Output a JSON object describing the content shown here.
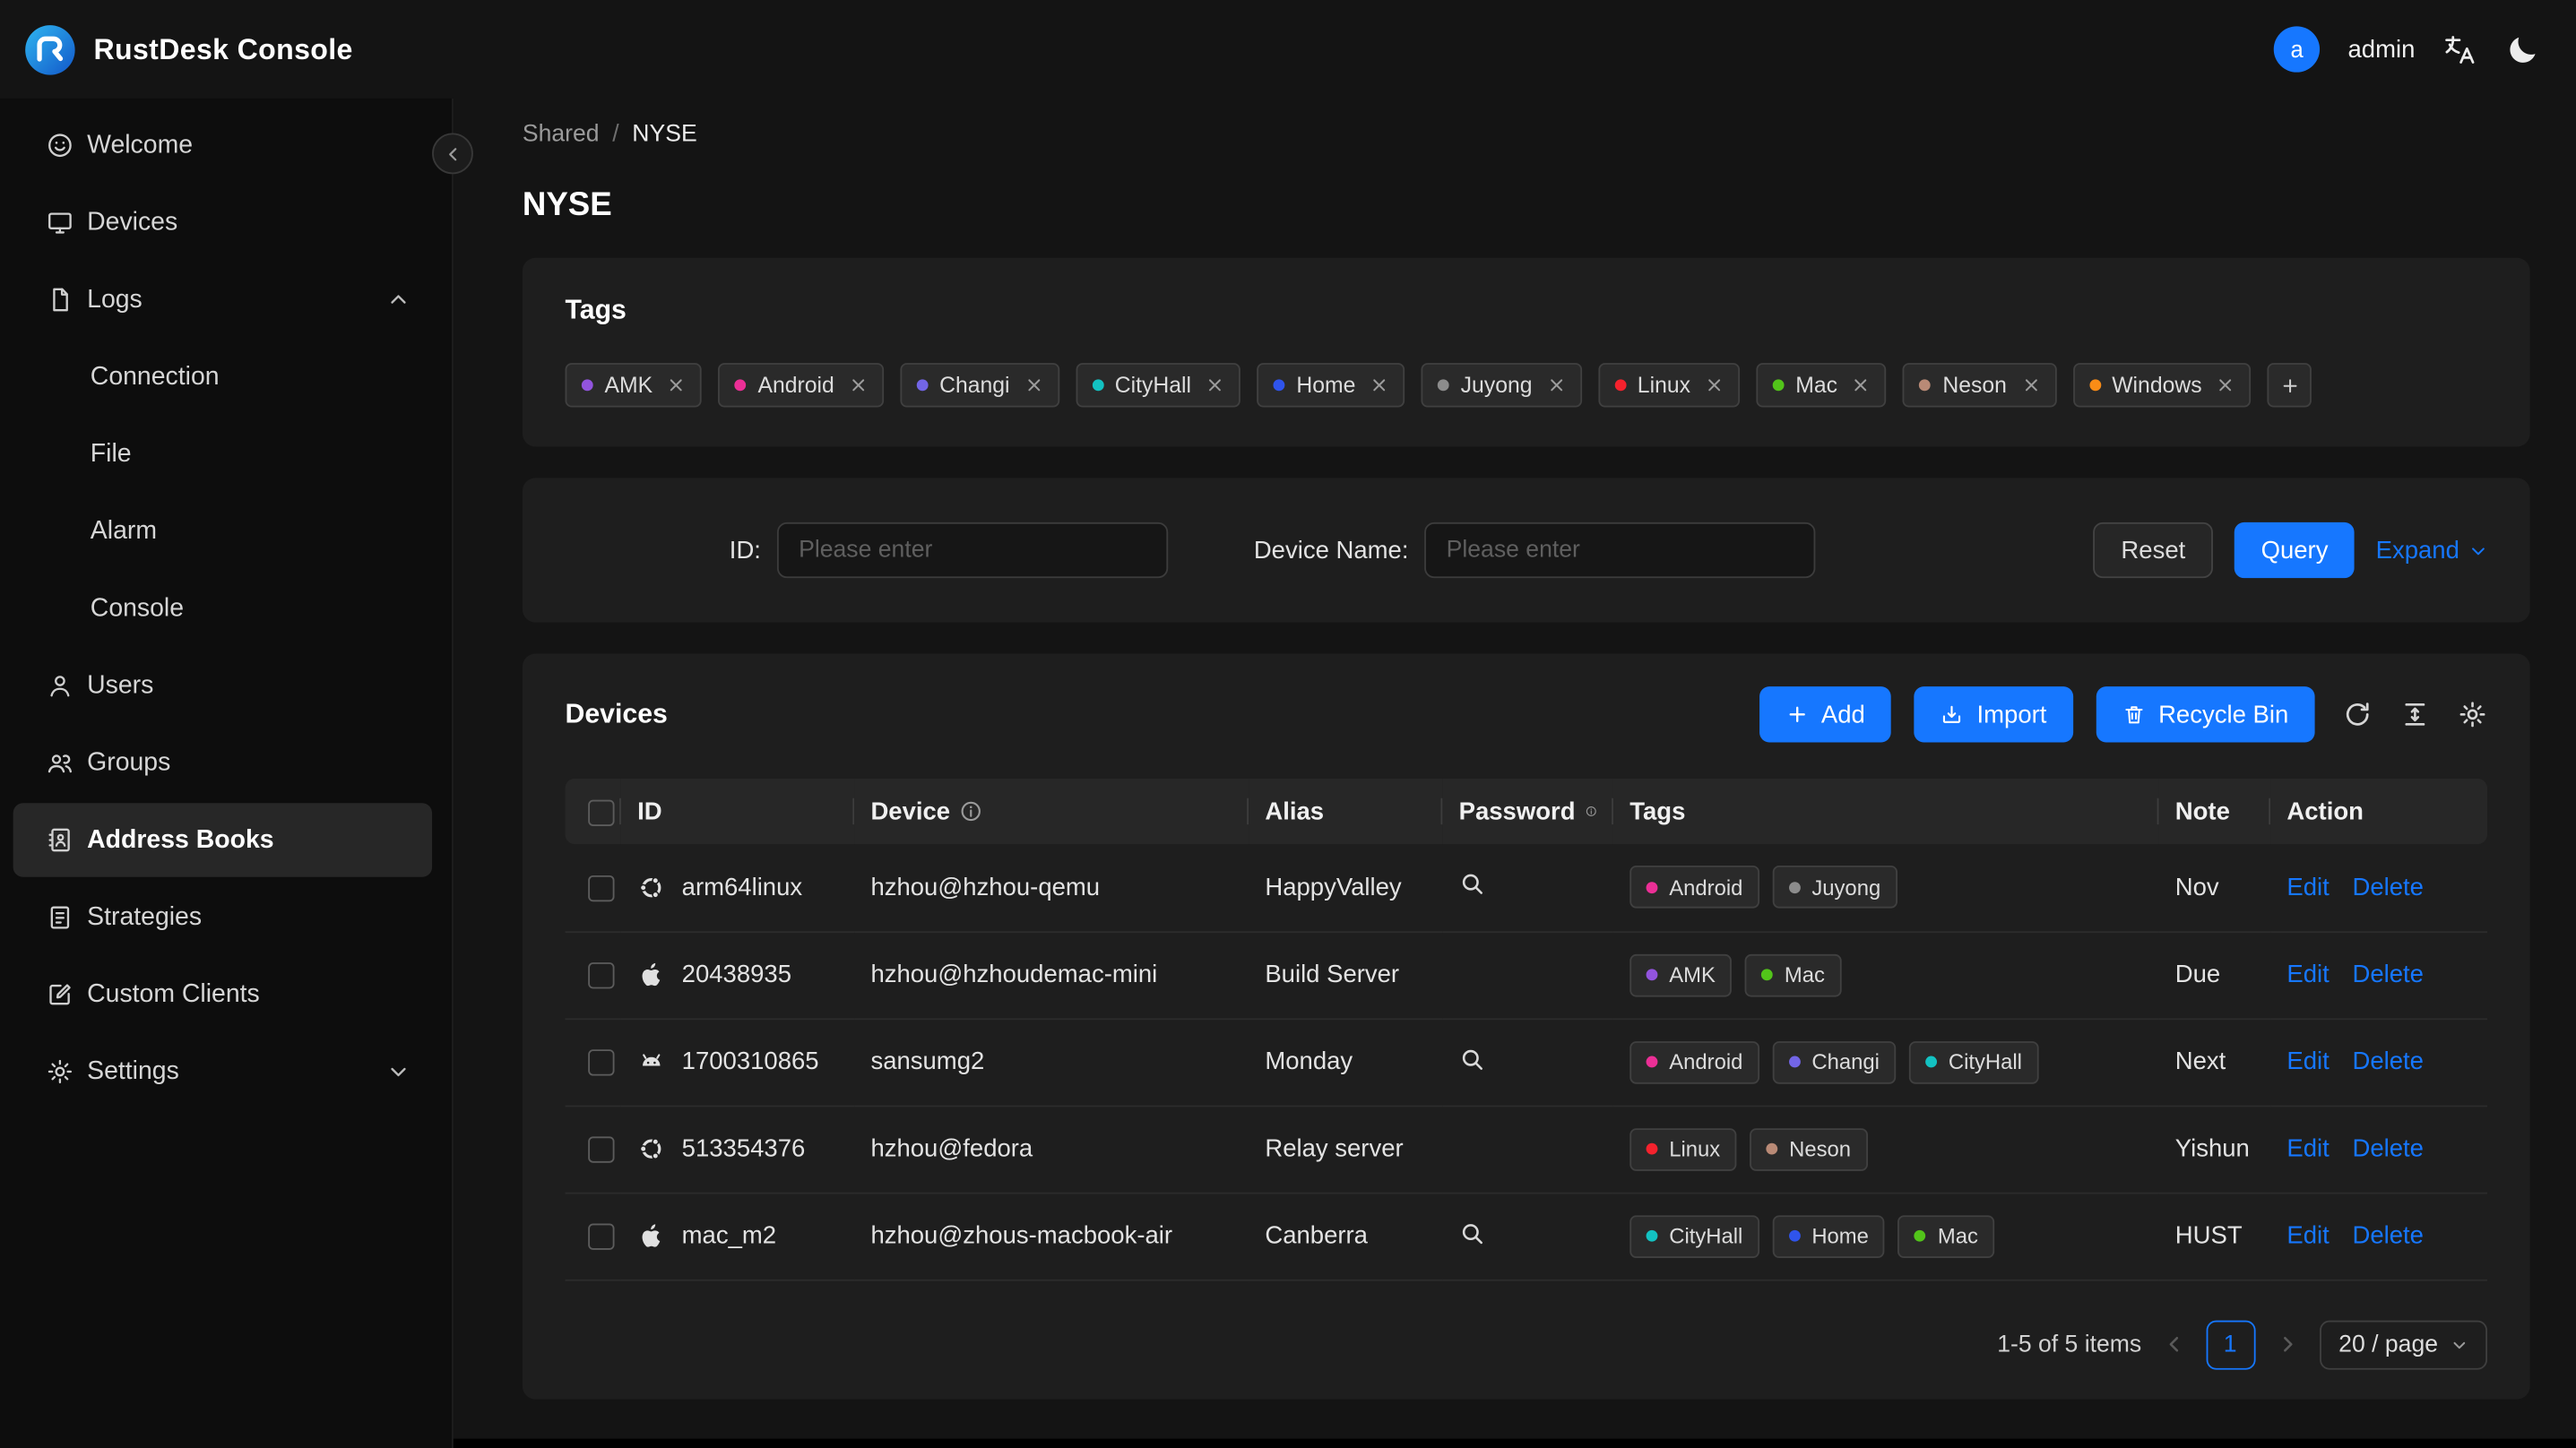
{
  "theme": {
    "accent": "#1677ff"
  },
  "header": {
    "title": "RustDesk Console",
    "user": {
      "initial": "a",
      "name": "admin"
    }
  },
  "sidebar": {
    "items": [
      {
        "label": "Welcome",
        "icon": "smile"
      },
      {
        "label": "Devices",
        "icon": "monitor"
      },
      {
        "label": "Logs",
        "icon": "file",
        "chevron": "up"
      },
      {
        "label": "Connection",
        "child": true
      },
      {
        "label": "File",
        "child": true
      },
      {
        "label": "Alarm",
        "child": true
      },
      {
        "label": "Console",
        "child": true
      },
      {
        "label": "Users",
        "icon": "user"
      },
      {
        "label": "Groups",
        "icon": "users"
      },
      {
        "label": "Address Books",
        "icon": "book",
        "selected": true
      },
      {
        "label": "Strategies",
        "icon": "strategy"
      },
      {
        "label": "Custom Clients",
        "icon": "editsq"
      },
      {
        "label": "Settings",
        "icon": "gear",
        "chevron": "down"
      }
    ]
  },
  "breadcrumb": {
    "parent": "Shared",
    "separator": "/",
    "current": "NYSE"
  },
  "page": {
    "title": "NYSE"
  },
  "tags_card": {
    "title": "Tags",
    "tags": [
      {
        "label": "AMK",
        "color": "#9254de"
      },
      {
        "label": "Android",
        "color": "#eb2f96"
      },
      {
        "label": "Changi",
        "color": "#7265e6"
      },
      {
        "label": "CityHall",
        "color": "#13c2c2"
      },
      {
        "label": "Home",
        "color": "#2f54eb"
      },
      {
        "label": "Juyong",
        "color": "#8c8c8c"
      },
      {
        "label": "Linux",
        "color": "#f5222d"
      },
      {
        "label": "Mac",
        "color": "#52c41a"
      },
      {
        "label": "Neson",
        "color": "#b98a76"
      },
      {
        "label": "Windows",
        "color": "#fa8c16"
      }
    ]
  },
  "filter": {
    "id_label": "ID:",
    "device_label": "Device Name:",
    "placeholder": "Please enter",
    "reset": "Reset",
    "query": "Query",
    "expand": "Expand"
  },
  "devices": {
    "title": "Devices",
    "add_label": "Add",
    "import_label": "Import",
    "recycle_label": "Recycle Bin",
    "table": {
      "columns": [
        {
          "key": "select",
          "label": ""
        },
        {
          "key": "id",
          "label": "ID"
        },
        {
          "key": "device",
          "label": "Device",
          "info": true
        },
        {
          "key": "alias",
          "label": "Alias"
        },
        {
          "key": "password",
          "label": "Password",
          "info": true
        },
        {
          "key": "tags",
          "label": "Tags"
        },
        {
          "key": "note",
          "label": "Note"
        },
        {
          "key": "action",
          "label": "Action"
        }
      ],
      "edit_label": "Edit",
      "delete_label": "Delete",
      "rows": [
        {
          "os": "ubuntu",
          "id": "arm64linux",
          "device": "hzhou@hzhou-qemu",
          "alias": "HappyValley",
          "password_search": true,
          "tags": [
            "Android",
            "Juyong"
          ],
          "note": "Nov"
        },
        {
          "os": "apple",
          "id": "20438935",
          "device": "hzhou@hzhoudemac-mini",
          "alias": "Build Server",
          "password_search": false,
          "tags": [
            "AMK",
            "Mac"
          ],
          "note": "Due"
        },
        {
          "os": "android",
          "id": "1700310865",
          "device": "sansumg2",
          "alias": "Monday",
          "password_search": true,
          "tags": [
            "Android",
            "Changi",
            "CityHall"
          ],
          "note": "Next"
        },
        {
          "os": "ubuntu",
          "id": "513354376",
          "device": "hzhou@fedora",
          "alias": "Relay server",
          "password_search": false,
          "tags": [
            "Linux",
            "Neson"
          ],
          "note": "Yishun"
        },
        {
          "os": "apple",
          "id": "mac_m2",
          "device": "hzhou@zhous-macbook-air",
          "alias": "Canberra",
          "password_search": true,
          "tags": [
            "CityHall",
            "Home",
            "Mac"
          ],
          "note": "HUST"
        }
      ]
    },
    "pagination": {
      "total": "1-5 of 5 items",
      "page": "1",
      "size": "20 / page"
    }
  }
}
